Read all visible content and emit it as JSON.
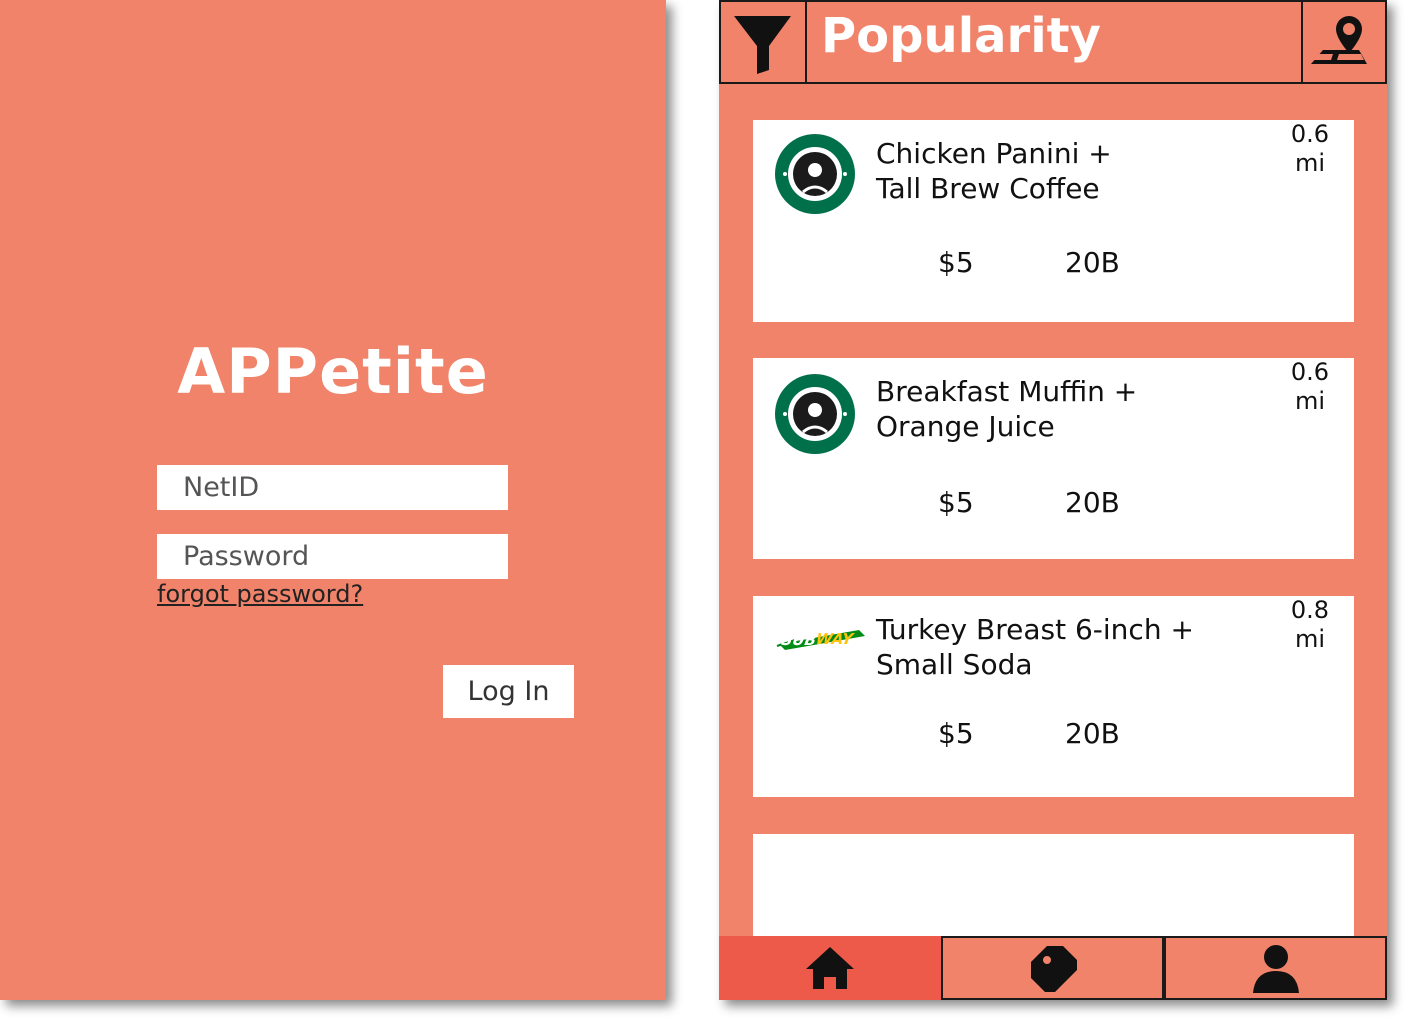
{
  "login": {
    "app_title": "APPetite",
    "netid_placeholder": "NetID",
    "password_placeholder": "Password",
    "forgot_label": "forgot password?",
    "login_label": "Log In"
  },
  "deals": {
    "header": {
      "filter_icon": "filter-icon",
      "title": "Popularity",
      "map_icon": "map-pin-icon"
    },
    "items": [
      {
        "brand": "starbucks-logo",
        "title_line1": "Chicken Panini +",
        "title_line2": "Tall Brew Coffee",
        "distance_value": "0.6",
        "distance_unit": "mi",
        "price": "$5",
        "location": "20B"
      },
      {
        "brand": "starbucks-logo",
        "title_line1": "Breakfast Muffin +",
        "title_line2": "Orange Juice",
        "distance_value": "0.6",
        "distance_unit": "mi",
        "price": "$5",
        "location": "20B"
      },
      {
        "brand": "subway-logo",
        "title_line1": "Turkey Breast 6-inch +",
        "title_line2": "Small Soda",
        "distance_value": "0.8",
        "distance_unit": "mi",
        "price": "$5",
        "location": "20B"
      }
    ],
    "nav": {
      "home_icon": "home-icon",
      "deals_icon": "tag-icon",
      "profile_icon": "user-icon"
    }
  },
  "colors": {
    "background": "#f0836a",
    "active_tab": "#ee5a4a",
    "starbucks_green": "#00704a",
    "subway_yellow": "#ffc20e",
    "subway_green": "#008c15"
  }
}
